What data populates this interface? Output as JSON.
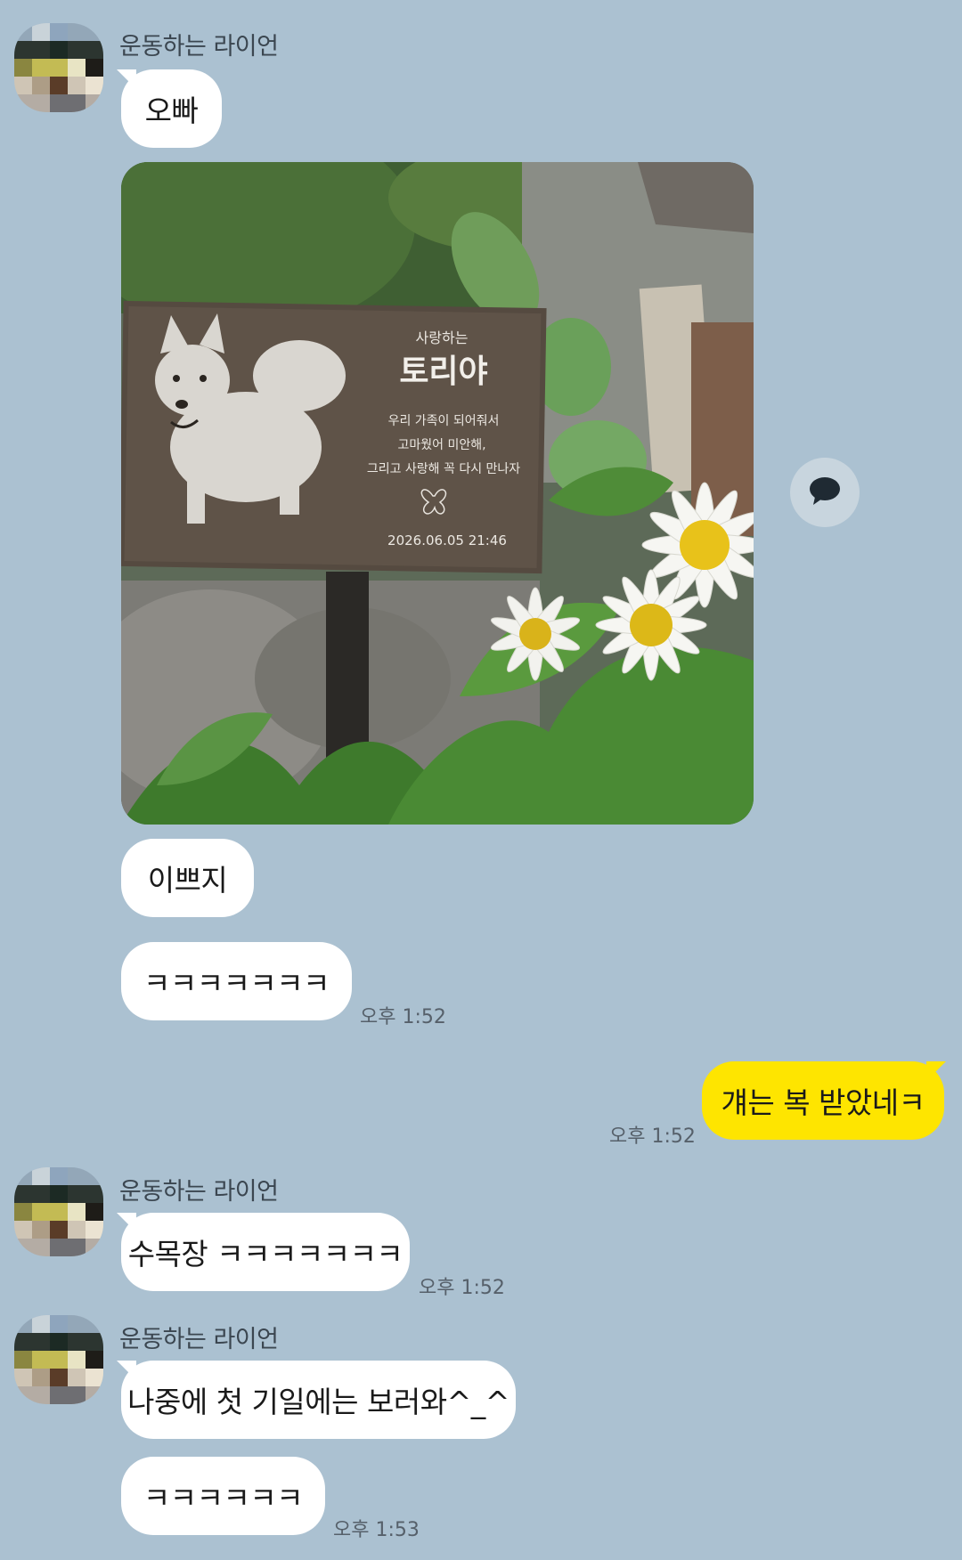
{
  "sender": {
    "name": "운동하는 라이언"
  },
  "messages": [
    {
      "id": "m1",
      "side": "in",
      "text": "오빠"
    },
    {
      "id": "m2",
      "side": "in",
      "type": "photo"
    },
    {
      "id": "m3",
      "side": "in",
      "text": "이쁘지"
    },
    {
      "id": "m4",
      "side": "in",
      "text": "ㅋㅋㅋㅋㅋㅋㅋ",
      "time": "오후 1:52"
    },
    {
      "id": "m5",
      "side": "out",
      "text": "걔는 복 받았네ㅋ",
      "time": "오후 1:52"
    },
    {
      "id": "m6",
      "side": "in",
      "text": "수목장 ㅋㅋㅋㅋㅋㅋㅋ",
      "time": "오후 1:52"
    },
    {
      "id": "m7",
      "side": "in",
      "text": "나중에 첫 기일에는 보러와^_^"
    },
    {
      "id": "m8",
      "side": "in",
      "text": "ㅋㅋㅋㅋㅋㅋ",
      "time": "오후 1:53"
    }
  ],
  "photo": {
    "plaque_heading": "사랑하는",
    "plaque_name": "토리야",
    "plaque_lines": [
      "우리 가족이 되어줘서",
      "고마웠어 미안해,",
      "그리고 사랑해 꼭 다시 만나자"
    ],
    "plaque_date": "2026.06.05 21:46"
  },
  "icons": {
    "share": "speech-bubble-icon"
  },
  "colors": {
    "background": "#abc1d1",
    "incoming_bubble": "#ffffff",
    "outgoing_bubble": "#fee500"
  }
}
